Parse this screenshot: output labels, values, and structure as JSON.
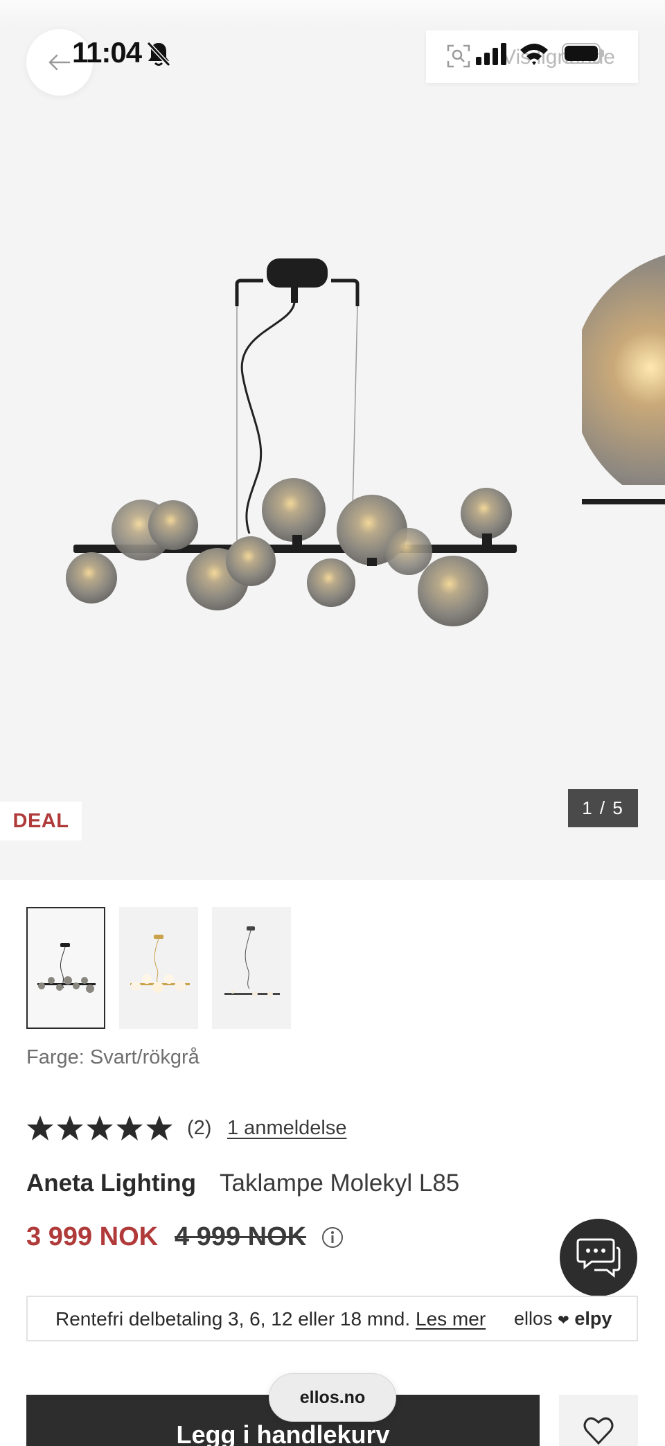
{
  "status_bar": {
    "time": "11:04"
  },
  "header": {
    "similar_label": "Vis lignende"
  },
  "gallery": {
    "badge": "DEAL",
    "counter": "1 / 5",
    "thumbnail_count": 3,
    "active_index": 1
  },
  "product": {
    "color_line": "Farge: Svart/rökgrå",
    "rating": {
      "stars": 5,
      "max": 5,
      "count": "(2)",
      "reviews_link": "1 anmeldelse"
    },
    "brand": "Aneta Lighting",
    "name": "Taklampe Molekyl L85",
    "price_now": "3 999 NOK",
    "price_old": "4 999 NOK"
  },
  "finance": {
    "text": "Rentefri delbetaling 3, 6, 12 eller 18 mnd.",
    "link": "Les mer",
    "logo_left": "ellos",
    "logo_right": "elpy"
  },
  "actions": {
    "cart_label": "Legg i handlekurv"
  },
  "browser": {
    "url": "ellos.no"
  },
  "colors": {
    "accent_red": "#b03a3a",
    "dark": "#2d2d2d",
    "hero_bg": "#f4f4f4"
  },
  "icons": [
    "back-arrow-icon",
    "bell-off-icon",
    "scan-icon",
    "signal-icon",
    "wifi-icon",
    "battery-icon",
    "star-icon",
    "info-icon",
    "chat-icon",
    "heart-icon"
  ]
}
